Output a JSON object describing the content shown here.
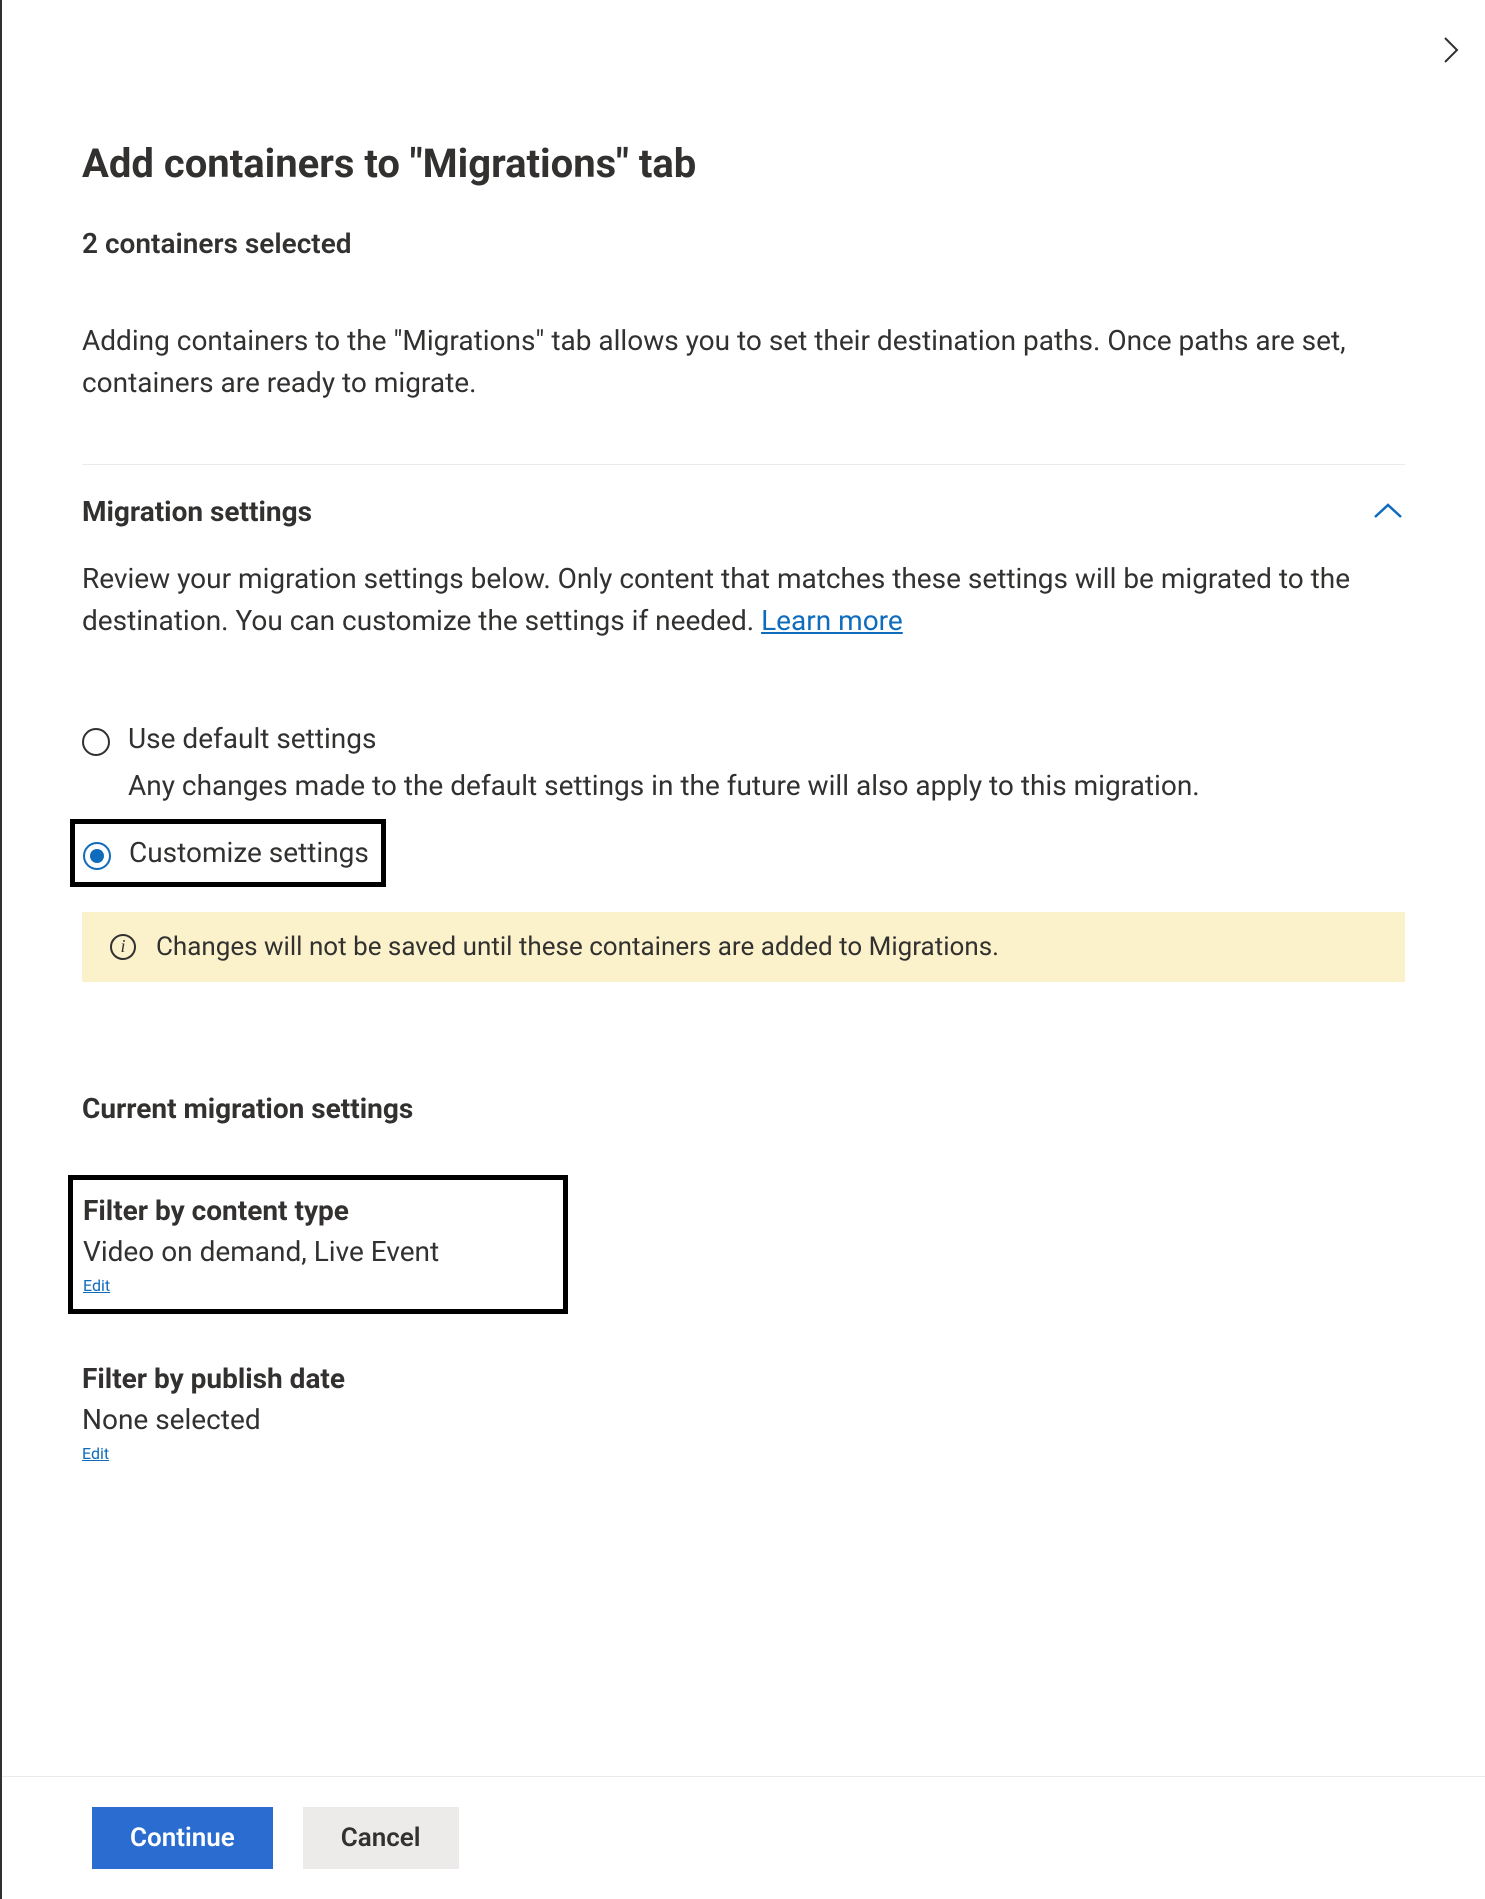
{
  "header": {
    "title": "Add containers to \"Migrations\" tab",
    "subtitle": "2 containers selected",
    "description": "Adding containers to the \"Migrations\" tab allows you to set their destination paths. Once paths are set, containers are ready to migrate."
  },
  "migration_settings": {
    "section_title": "Migration settings",
    "section_desc_prefix": "Review your migration settings below. Only content that matches these settings will be migrated to the destination. You can customize the settings if needed. ",
    "learn_more": "Learn more",
    "options": {
      "default_label": "Use default settings",
      "default_sub": "Any changes made to the default settings in the future will also apply to this migration.",
      "customize_label": "Customize settings"
    },
    "info_banner": "Changes will not be saved until these containers are added to Migrations."
  },
  "current_settings": {
    "section_title": "Current migration settings",
    "content_type": {
      "title": "Filter by content type",
      "value": "Video on demand, Live Event",
      "edit": "Edit"
    },
    "publish_date": {
      "title": "Filter by publish date",
      "value": "None selected",
      "edit": "Edit"
    }
  },
  "footer": {
    "continue": "Continue",
    "cancel": "Cancel"
  }
}
